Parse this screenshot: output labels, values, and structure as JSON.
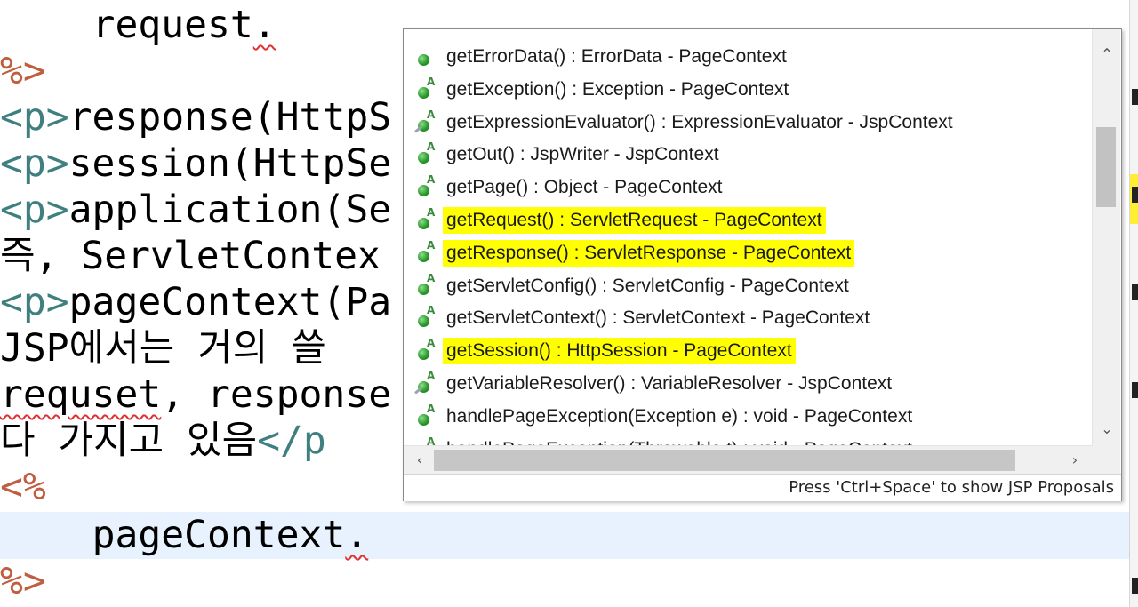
{
  "editor": {
    "lines": {
      "l1": {
        "code": "request",
        "dot": "."
      },
      "l2": {
        "jsp": "%>"
      },
      "l3": {
        "open": "<p>",
        "text": "response(HttpS"
      },
      "l4": {
        "open": "<p>",
        "text": "session(HttpSe"
      },
      "l5": {
        "open": "<p>",
        "text": "application(Se"
      },
      "l6": {
        "text": "즉, ServletContex"
      },
      "l7": {
        "open": "<p>",
        "text": "pageContext(Pa"
      },
      "l8": {
        "text": "JSP에서는 거의 쓸"
      },
      "l9": {
        "squig": "requset",
        "text": ", response"
      },
      "l10": {
        "text": "다 가지고 있음",
        "close": "</p"
      },
      "l11": {
        "jsp": "<%"
      },
      "l12": {
        "code": "pageContext",
        "dot": "."
      },
      "l13": {
        "jsp": "%>"
      }
    }
  },
  "popup": {
    "items": [
      {
        "icon": "public-method-icon",
        "label": "getErrorData() : ErrorData - PageContext",
        "highlighted": false
      },
      {
        "icon": "abstract-method-icon",
        "label": "getException() : Exception - PageContext",
        "highlighted": false
      },
      {
        "icon": "deprecated-abstract-method-icon",
        "label": "getExpressionEvaluator() : ExpressionEvaluator - JspContext",
        "highlighted": false
      },
      {
        "icon": "abstract-method-icon",
        "label": "getOut() : JspWriter - JspContext",
        "highlighted": false
      },
      {
        "icon": "abstract-method-icon",
        "label": "getPage() : Object - PageContext",
        "highlighted": false
      },
      {
        "icon": "abstract-method-icon",
        "label": "getRequest() : ServletRequest - PageContext",
        "highlighted": true
      },
      {
        "icon": "abstract-method-icon",
        "label": "getResponse() : ServletResponse - PageContext",
        "highlighted": true
      },
      {
        "icon": "abstract-method-icon",
        "label": "getServletConfig() : ServletConfig - PageContext",
        "highlighted": false
      },
      {
        "icon": "abstract-method-icon",
        "label": "getServletContext() : ServletContext - PageContext",
        "highlighted": false
      },
      {
        "icon": "abstract-method-icon",
        "label": "getSession() : HttpSession - PageContext",
        "highlighted": true
      },
      {
        "icon": "deprecated-abstract-method-icon",
        "label": "getVariableResolver() : VariableResolver - JspContext",
        "highlighted": false
      },
      {
        "icon": "abstract-method-icon",
        "label": "handlePageException(Exception e) : void - PageContext",
        "highlighted": false
      },
      {
        "icon": "abstract-method-icon",
        "label": "handlePageException(Throwable t) : void - PageContext",
        "highlighted": false
      }
    ],
    "status": "Press 'Ctrl+Space' to show JSP Proposals"
  },
  "colors": {
    "tag": "#3f7f7f",
    "jsp_delimiter": "#bf5f3f",
    "highlight": "#ffff00",
    "current_line": "#e8f2fe"
  }
}
